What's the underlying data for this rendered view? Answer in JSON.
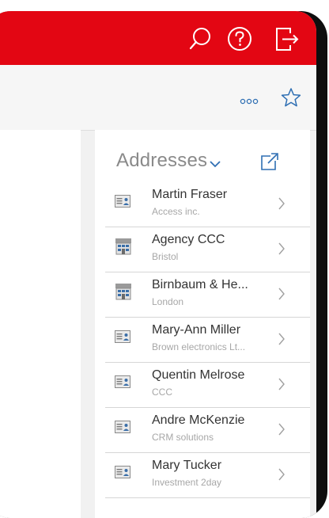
{
  "header": {
    "icons": [
      "search-icon",
      "help-icon",
      "logout-icon"
    ],
    "accent": "#e30613"
  },
  "toolbar": {
    "icons": [
      "more-icon",
      "favorite-star-icon"
    ]
  },
  "addresses": {
    "title": "Addresses",
    "items": [
      {
        "name": "Martin Fraser",
        "sub": "Access inc.",
        "icon": "contact-card-icon"
      },
      {
        "name": "Agency CCC",
        "sub": "Bristol",
        "icon": "company-building-icon"
      },
      {
        "name": "Birnbaum & He...",
        "sub": "London",
        "icon": "company-building-icon"
      },
      {
        "name": "Mary-Ann Miller",
        "sub": "Brown electronics Lt...",
        "icon": "contact-card-icon"
      },
      {
        "name": "Quentin Melrose",
        "sub": "CCC",
        "icon": "contact-card-icon"
      },
      {
        "name": "Andre McKenzie",
        "sub": "CRM solutions",
        "icon": "contact-card-icon"
      },
      {
        "name": "Mary Tucker",
        "sub": "Investment 2day",
        "icon": "contact-card-icon"
      }
    ]
  }
}
